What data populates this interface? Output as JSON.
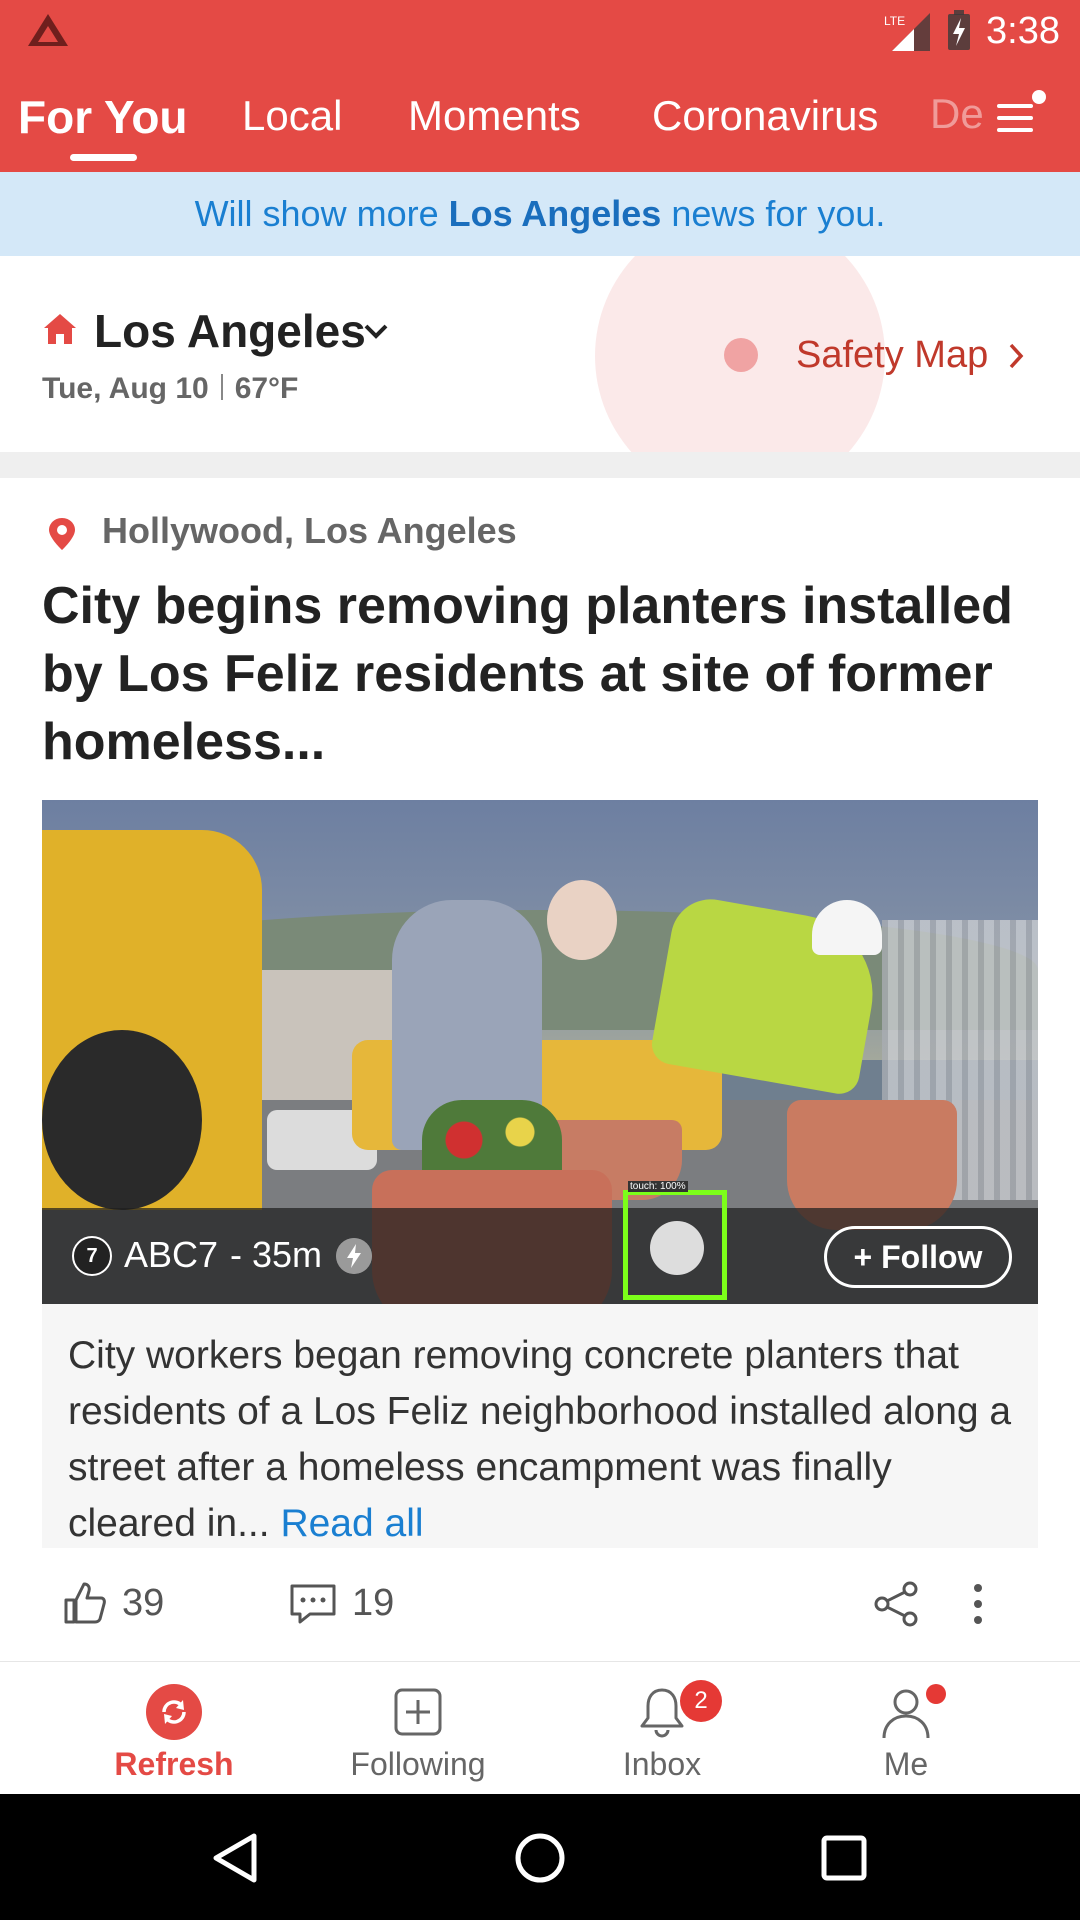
{
  "status_bar": {
    "time": "3:38",
    "network": "LTE"
  },
  "top_tabs": [
    {
      "label": "For You",
      "active": true
    },
    {
      "label": "Local"
    },
    {
      "label": "Moments"
    },
    {
      "label": "Coronavirus"
    },
    {
      "label": "De"
    }
  ],
  "banner": {
    "prefix": "Will show more ",
    "city": "Los Angeles",
    "suffix": " news for you."
  },
  "location": {
    "city": "Los Angeles",
    "date": "Tue, Aug 10",
    "temp": "67°F",
    "safety_map_label": "Safety Map"
  },
  "article": {
    "area": "Hollywood, Los Angeles",
    "headline": "City begins removing planters installed by Los Feliz residents at site of former homeless...",
    "source": "ABC7",
    "time": "- 35m",
    "follow_label": "+ Follow",
    "touch_tag": "touch: 100%",
    "summary": "City workers began removing concrete planters that residents of a Los Feliz neighborhood installed along a street after a homeless encampment was finally cleared in...",
    "read_all": "Read all",
    "likes": "39",
    "comments": "19"
  },
  "bottom_nav": {
    "refresh": "Refresh",
    "following": "Following",
    "inbox": "Inbox",
    "inbox_badge": "2",
    "me": "Me"
  },
  "colors": {
    "brand": "#e44a45",
    "link": "#1a7fd1",
    "banner_bg": "#d4e8f8"
  },
  "icons": [
    "app-logo-icon",
    "signal-icon",
    "battery-icon",
    "menu-icon",
    "home-icon",
    "chevron-down-icon",
    "chevron-right-icon",
    "location-pin-icon",
    "bolt-icon",
    "thumbs-up-icon",
    "comment-icon",
    "share-icon",
    "more-vertical-icon",
    "refresh-icon",
    "following-icon",
    "bell-icon",
    "person-icon",
    "back-icon",
    "home-circle-icon",
    "recents-icon"
  ]
}
